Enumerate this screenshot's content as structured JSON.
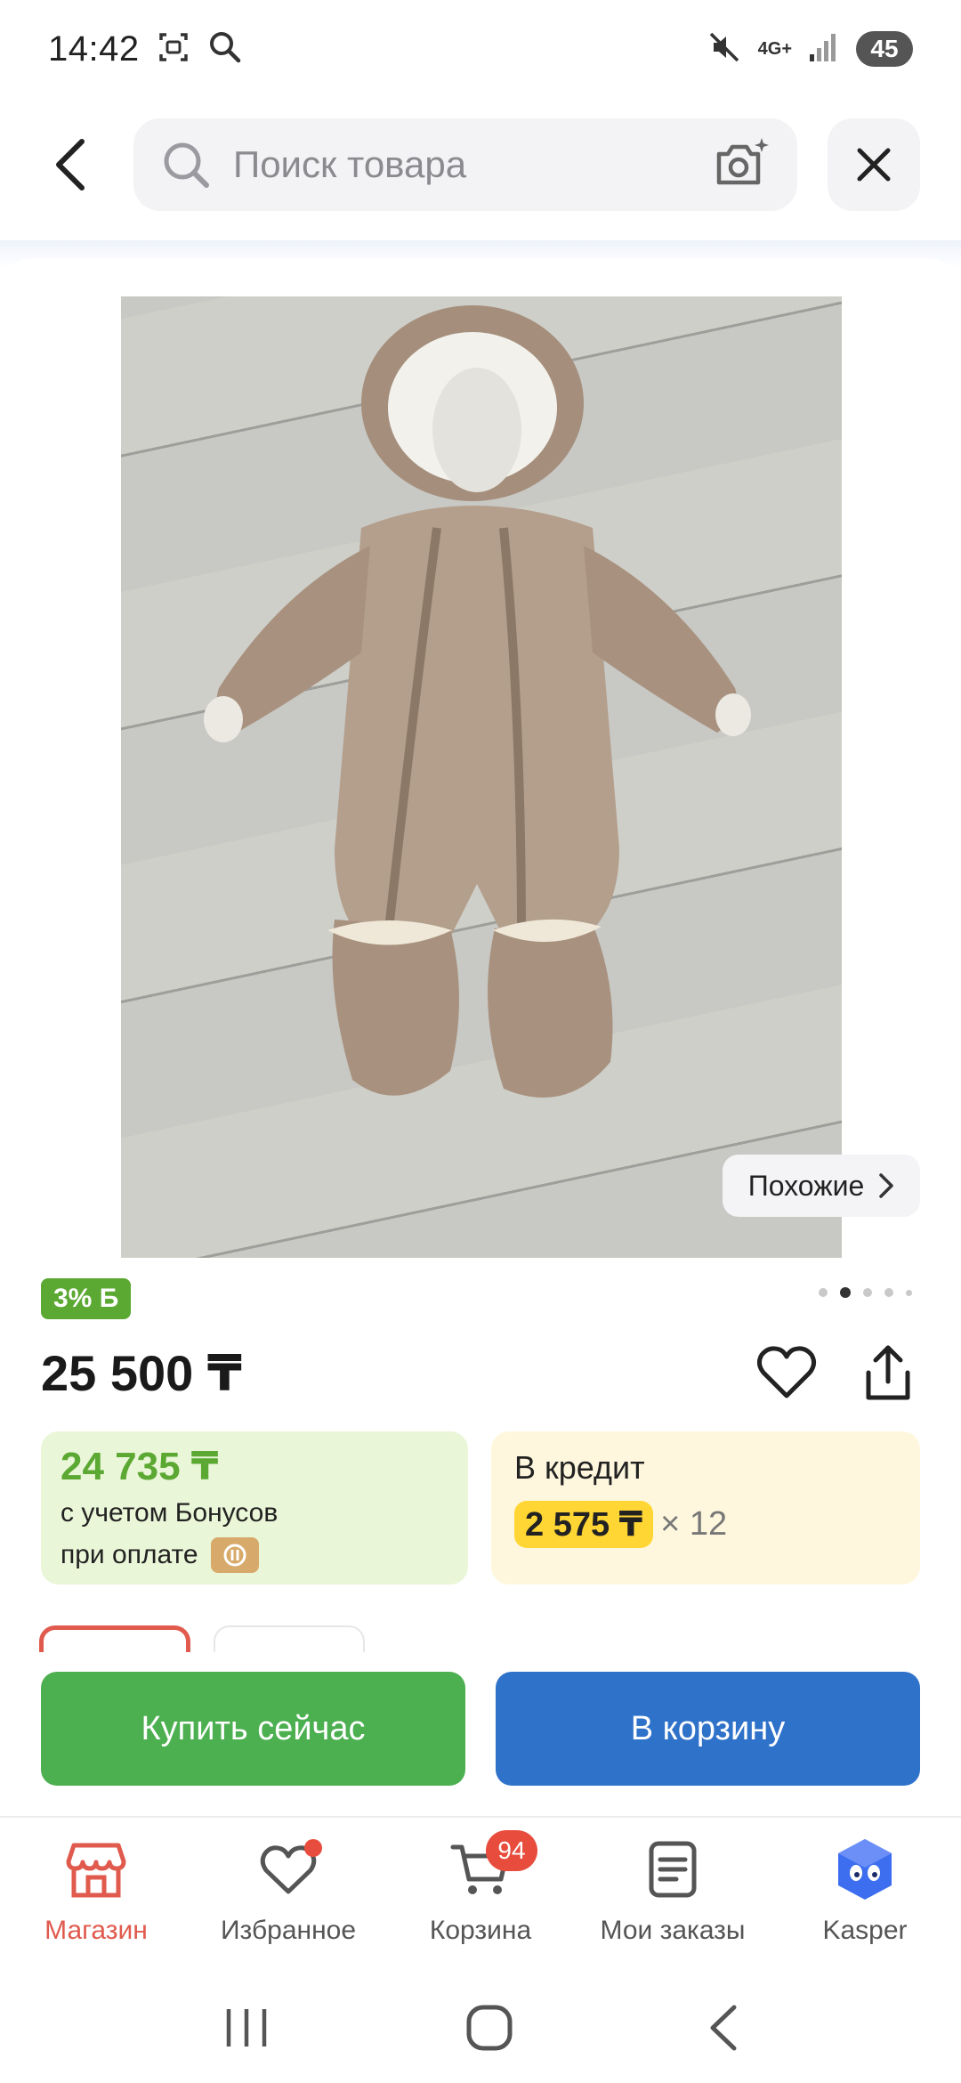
{
  "status": {
    "time": "14:42",
    "network": "4G+",
    "battery": "45"
  },
  "search": {
    "placeholder": "Поиск товара"
  },
  "product": {
    "similar_label": "Похожие",
    "bonus_badge": "3% Б",
    "price": "25 500 ₸",
    "image_count": 5,
    "active_image": 2
  },
  "bonus_offer": {
    "price": "24 735 ₸",
    "line1": "с учетом Бонусов",
    "line2": "при оплате"
  },
  "credit_offer": {
    "title": "В кредит",
    "amount": "2 575 ₸",
    "multiplier": "× 12"
  },
  "actions": {
    "buy_now": "Купить сейчас",
    "add_to_cart": "В корзину"
  },
  "nav": {
    "items": [
      {
        "label": "Магазин",
        "icon": "store-icon",
        "active": true
      },
      {
        "label": "Избранное",
        "icon": "heart-icon"
      },
      {
        "label": "Корзина",
        "icon": "cart-icon",
        "badge": "94"
      },
      {
        "label": "Мои заказы",
        "icon": "orders-icon"
      },
      {
        "label": "Kasper",
        "icon": "kasper-icon"
      }
    ]
  },
  "colors": {
    "accent_red": "#e05a4d",
    "bonus_green": "#5ba832",
    "buy_green": "#4caf50",
    "cart_blue": "#2f72c9",
    "credit_yellow": "#ffd633"
  }
}
